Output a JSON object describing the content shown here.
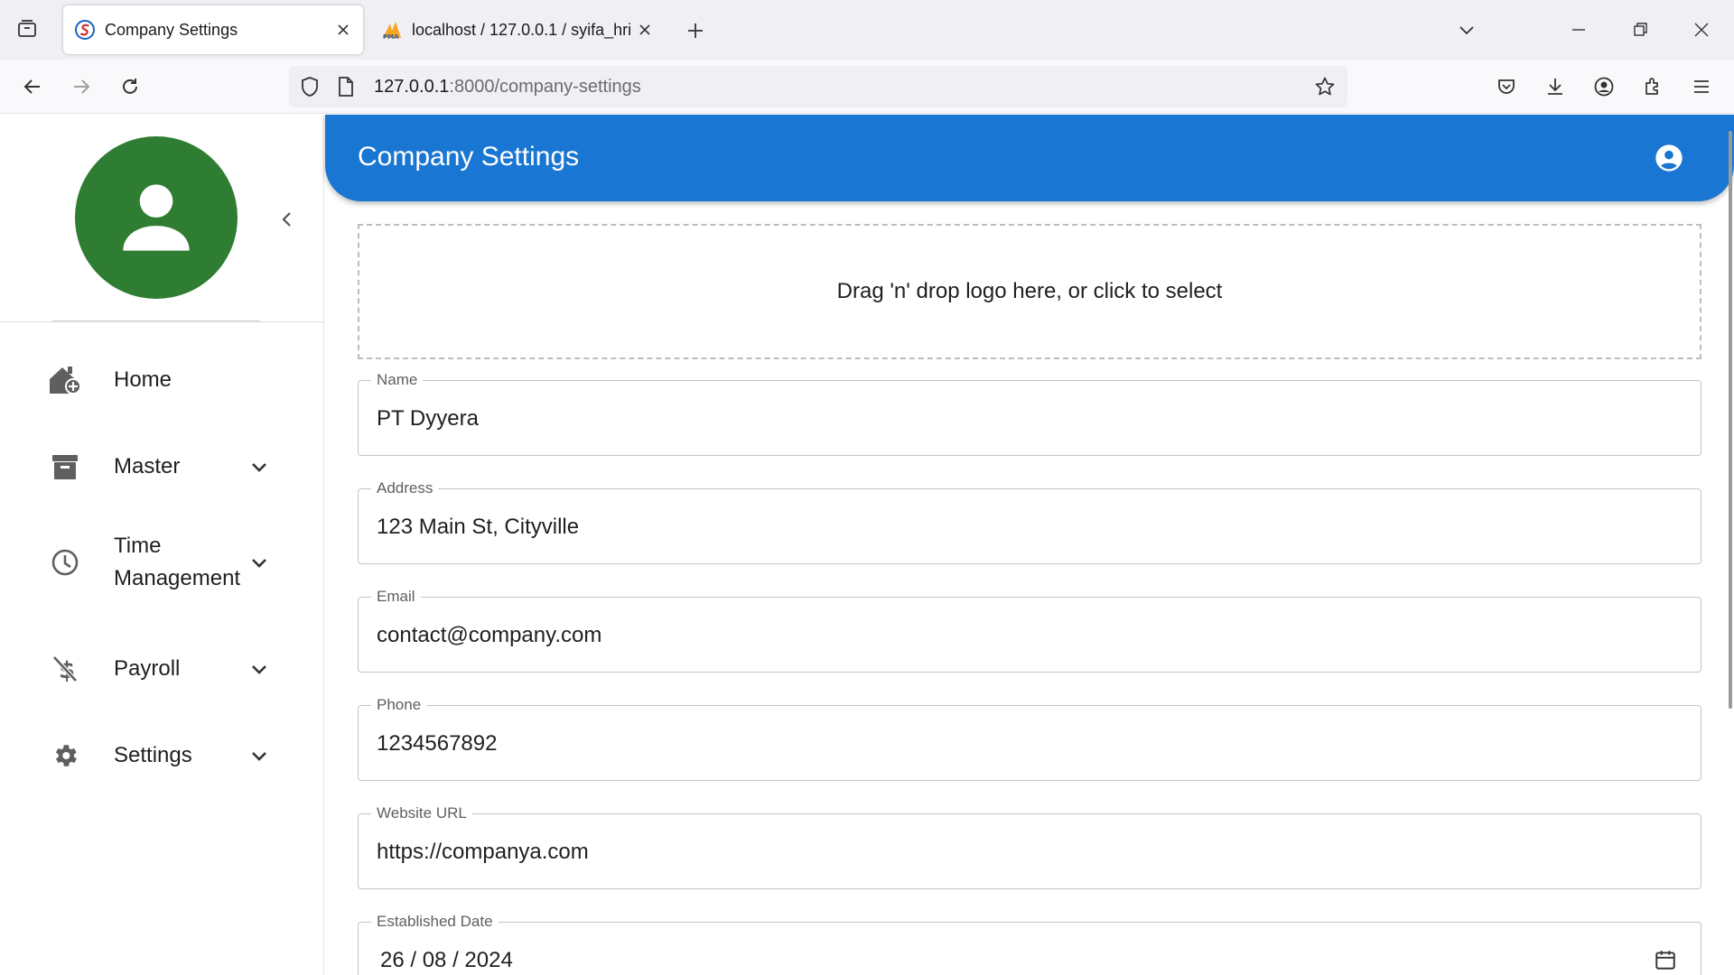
{
  "browser": {
    "tabs": [
      {
        "title": "Company Settings",
        "active": true,
        "icon": "app-favicon"
      },
      {
        "title": "localhost / 127.0.0.1 / syifa_hris",
        "active": false,
        "icon": "phpmyadmin-favicon"
      }
    ],
    "url_host": "127.0.0.1",
    "url_path": ":8000/company-settings"
  },
  "sidebar": {
    "avatar_icon": "person-icon",
    "items": [
      {
        "label": "Home",
        "icon": "home-icon",
        "has_submenu": false
      },
      {
        "label": "Master",
        "icon": "archive-icon",
        "has_submenu": true
      },
      {
        "label": "Time Management",
        "icon": "clock-icon",
        "has_submenu": true
      },
      {
        "label": "Payroll",
        "icon": "money-off-icon",
        "has_submenu": true
      },
      {
        "label": "Settings",
        "icon": "gear-icon",
        "has_submenu": true
      }
    ]
  },
  "header": {
    "title": "Company Settings"
  },
  "dropzone": {
    "text": "Drag 'n' drop logo here, or click to select"
  },
  "form": {
    "name": {
      "label": "Name",
      "value": "PT Dyyera"
    },
    "address": {
      "label": "Address",
      "value": "123 Main St, Cityville"
    },
    "email": {
      "label": "Email",
      "value": "contact@company.com"
    },
    "phone": {
      "label": "Phone",
      "value": "1234567892"
    },
    "website": {
      "label": "Website URL",
      "value": "https://companya.com"
    },
    "established": {
      "label": "Established Date",
      "value": "26 / 08 / 2024"
    }
  },
  "colors": {
    "appbar": "#1976d2",
    "avatar": "#2e7d32"
  }
}
